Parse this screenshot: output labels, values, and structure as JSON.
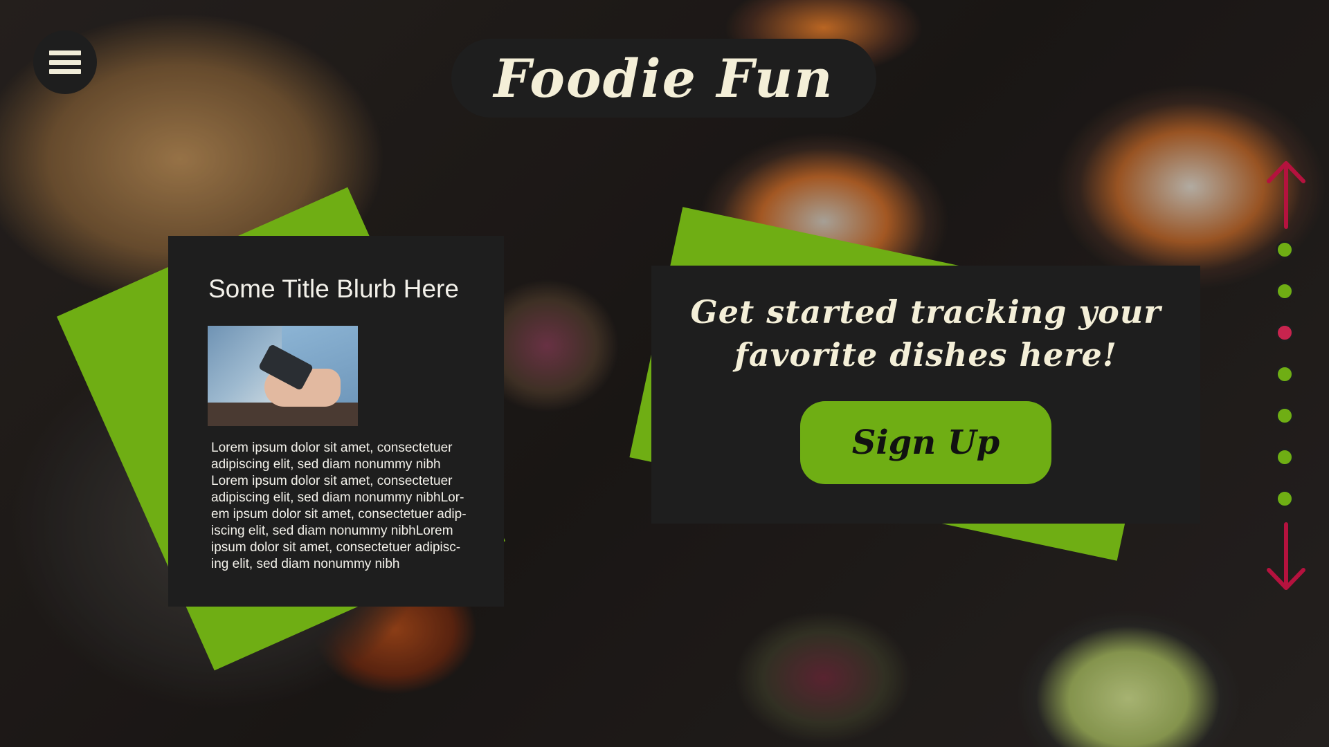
{
  "header": {
    "title": "Foodie Fun"
  },
  "menu": {
    "icon": "hamburger-menu-icon"
  },
  "info_card": {
    "title": "Some Title Blurb Here",
    "image_icon": "phone-in-hand-photo",
    "body_lines": [
      "Lorem ipsum dolor sit amet, consectetuer",
      "adipiscing elit, sed diam nonummy nibh",
      "Lorem ipsum dolor sit amet, consectetuer",
      "adipiscing elit, sed diam nonummy nibhLor-",
      "em ipsum dolor sit amet, consectetuer adip-",
      "iscing elit, sed diam nonummy nibhLorem",
      "ipsum dolor sit amet, consectetuer adipisc-",
      "ing elit, sed diam nonummy nibh"
    ]
  },
  "cta_card": {
    "headline_line1": "Get started tracking your",
    "headline_line2": "favorite dishes here!",
    "signup_label": "Sign Up"
  },
  "pager": {
    "up_icon": "arrow-up-icon",
    "down_icon": "arrow-down-icon",
    "dots": [
      "green",
      "green",
      "active",
      "green",
      "green",
      "green",
      "green"
    ],
    "active_index": 2
  },
  "colors": {
    "accent_green": "#6fae14",
    "active_red": "#c8244e",
    "arrow_red": "#b5123e",
    "panel": "#1e1e1e",
    "cream_text": "#f4efd8"
  }
}
